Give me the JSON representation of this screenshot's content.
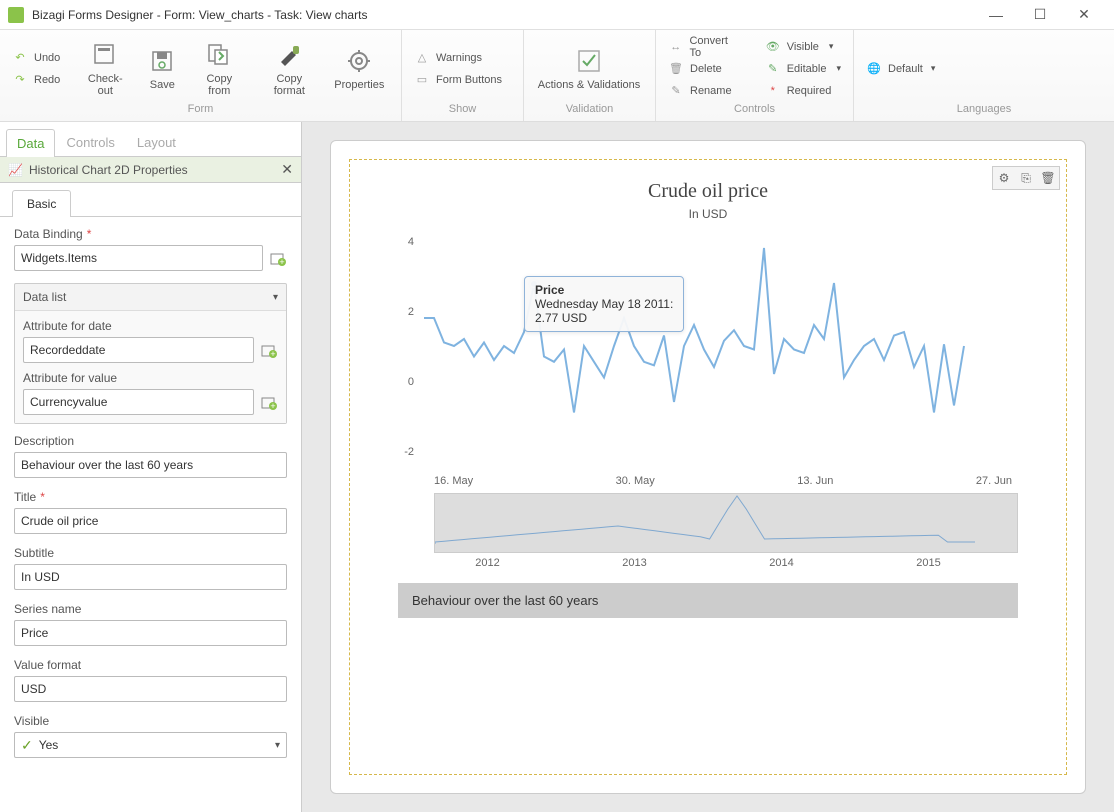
{
  "window": {
    "title": "Bizagi Forms Designer  - Form: View_charts - Task:  View charts"
  },
  "ribbon": {
    "undo": "Undo",
    "redo": "Redo",
    "checkout": "Check-out",
    "save": "Save",
    "copyfrom": "Copy from",
    "copyformat": "Copy format",
    "properties": "Properties",
    "group_form": "Form",
    "warnings": "Warnings",
    "formbuttons": "Form Buttons",
    "group_show": "Show",
    "actions": "Actions & Validations",
    "group_validation": "Validation",
    "convert": "Convert To",
    "delete": "Delete",
    "rename": "Rename",
    "visible": "Visible",
    "editable": "Editable",
    "required": "Required",
    "group_controls": "Controls",
    "default": "Default",
    "group_lang": "Languages"
  },
  "panel": {
    "tabs": {
      "data": "Data",
      "controls": "Controls",
      "layout": "Layout"
    },
    "header": "Historical Chart 2D Properties",
    "subtab_basic": "Basic",
    "fields": {
      "databinding_label": "Data Binding",
      "databinding_value": "Widgets.Items",
      "datalist_label": "Data list",
      "attrdate_label": "Attribute for date",
      "attrdate_value": "Recordeddate",
      "attrvalue_label": "Attribute for value",
      "attrvalue_value": "Currencyvalue",
      "description_label": "Description",
      "description_value": "Behaviour over the last 60 years",
      "title_label": "Title",
      "title_value": "Crude oil price",
      "subtitle_label": "Subtitle",
      "subtitle_value": "In USD",
      "seriesname_label": "Series name",
      "seriesname_value": "Price",
      "valueformat_label": "Value format",
      "valueformat_value": "USD",
      "visible_label": "Visible",
      "visible_value": "Yes"
    }
  },
  "chart_data": {
    "type": "line",
    "title": "Crude oil price",
    "subtitle": "In USD",
    "series_name": "Price",
    "xlabel": "",
    "ylabel": "",
    "ylim": [
      -2,
      4
    ],
    "y_ticks": [
      -2,
      0,
      2,
      4
    ],
    "x_ticks": [
      "16. May",
      "30. May",
      "13. Jun",
      "27. Jun"
    ],
    "x": [
      "2011-05-05",
      "2011-05-06",
      "2011-05-07",
      "2011-05-09",
      "2011-05-10",
      "2011-05-11",
      "2011-05-12",
      "2011-05-13",
      "2011-05-14",
      "2011-05-16",
      "2011-05-17",
      "2011-05-18",
      "2011-05-19",
      "2011-05-20",
      "2011-05-21",
      "2011-05-23",
      "2011-05-24",
      "2011-05-25",
      "2011-05-26",
      "2011-05-27",
      "2011-05-28",
      "2011-05-30",
      "2011-05-31",
      "2011-06-01",
      "2011-06-02",
      "2011-06-03",
      "2011-06-04",
      "2011-06-06",
      "2011-06-07",
      "2011-06-08",
      "2011-06-09",
      "2011-06-10",
      "2011-06-11",
      "2011-06-13",
      "2011-06-14",
      "2011-06-15",
      "2011-06-16",
      "2011-06-17",
      "2011-06-18",
      "2011-06-20",
      "2011-06-21",
      "2011-06-22",
      "2011-06-23",
      "2011-06-24",
      "2011-06-25",
      "2011-06-27",
      "2011-06-28",
      "2011-06-29",
      "2011-06-30",
      "2011-07-01",
      "2011-07-02",
      "2011-07-03",
      "2011-07-04",
      "2011-07-05",
      "2011-07-06"
    ],
    "values": [
      1.8,
      1.8,
      1.1,
      1.0,
      1.2,
      0.7,
      1.1,
      0.6,
      1.0,
      0.8,
      1.4,
      2.77,
      0.7,
      0.55,
      0.9,
      -0.9,
      1.0,
      0.55,
      0.1,
      1.0,
      1.8,
      1.0,
      0.55,
      0.45,
      1.3,
      -0.6,
      1.0,
      1.6,
      0.9,
      0.4,
      1.15,
      1.45,
      1.0,
      0.9,
      3.8,
      0.2,
      1.2,
      0.9,
      0.8,
      1.6,
      1.2,
      2.8,
      0.1,
      0.6,
      1.0,
      1.2,
      0.6,
      1.3,
      1.4,
      0.4,
      1.0,
      -0.9,
      1.05,
      -0.7,
      1.0
    ],
    "tooltip": {
      "series": "Price",
      "date": "Wednesday May 18 2011:",
      "value": "2.77 USD",
      "index": 11
    },
    "navigator_ticks": [
      "2012",
      "2013",
      "2014",
      "2015"
    ],
    "description": "Behaviour over the last 60 years"
  }
}
